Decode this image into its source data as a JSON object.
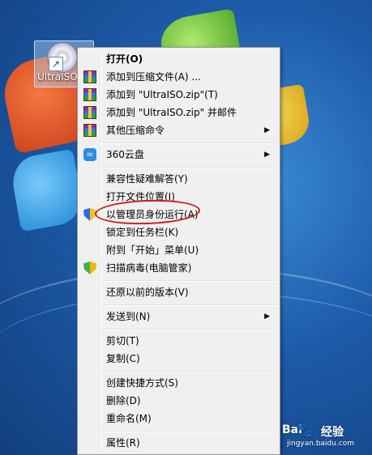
{
  "desktop_icon": {
    "label": "UltraISO",
    "shortcut_arrow": "↗"
  },
  "menu": {
    "items": [
      {
        "label": "打开(O)",
        "bold": true,
        "icon": null
      },
      {
        "label": "添加到压缩文件(A) ...",
        "icon": "winrar-icon"
      },
      {
        "label": "添加到 \"UltraISO.zip\"(T)",
        "icon": "winrar-icon"
      },
      {
        "label": "添加到 \"UltraISO.zip\" 并邮件",
        "icon": "winrar-icon"
      },
      {
        "label": "其他压缩命令",
        "icon": "winrar-icon",
        "submenu": true
      },
      {
        "label": "360云盘",
        "icon": "cloud-icon",
        "submenu": true
      },
      {
        "label": "兼容性疑难解答(Y)",
        "icon": null
      },
      {
        "label": "打开文件位置(I)",
        "icon": null
      },
      {
        "label": "以管理员身份运行(A)",
        "icon": "uac-shield-icon",
        "highlighted": true
      },
      {
        "label": "锁定到任务栏(K)",
        "icon": null
      },
      {
        "label": "附到「开始」菜单(U)",
        "icon": null
      },
      {
        "label": "扫描病毒(电脑管家)",
        "icon": "guard-shield-icon"
      },
      {
        "label": "还原以前的版本(V)",
        "icon": null
      },
      {
        "label": "发送到(N)",
        "icon": null,
        "submenu": true
      },
      {
        "label": "剪切(T)",
        "icon": null
      },
      {
        "label": "复制(C)",
        "icon": null
      },
      {
        "label": "创建快捷方式(S)",
        "icon": null
      },
      {
        "label": "删除(D)",
        "icon": null
      },
      {
        "label": "重命名(M)",
        "icon": null
      },
      {
        "label": "属性(R)",
        "icon": null
      }
    ],
    "submenu_arrow": "▶",
    "cloud_icon_glyph": "∞"
  },
  "annotation": {
    "color": "#d11a1a"
  },
  "watermark": {
    "brand": "Bai",
    "paw": "🐾",
    "jingyan": "经验",
    "url": "jingyan.baidu.com"
  }
}
